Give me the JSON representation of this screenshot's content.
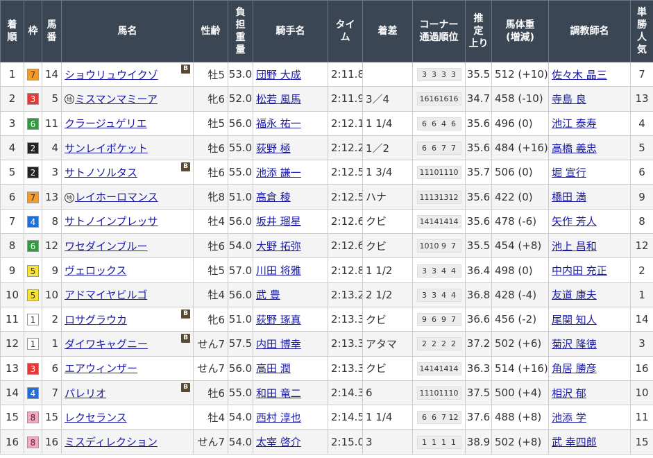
{
  "headers": [
    "着順",
    "枠",
    "馬番",
    "馬名",
    "性齢",
    "負担重量",
    "騎手名",
    "タイム",
    "着差",
    "コーナー通過順位",
    "推定上り",
    "馬体重(増減)",
    "調教師名",
    "単勝人気"
  ],
  "header_lines": {
    "rank": [
      "着",
      "順"
    ],
    "waku": [
      "枠"
    ],
    "umaban": [
      "馬",
      "番"
    ],
    "horse": [
      "馬名"
    ],
    "sexage": [
      "性齢"
    ],
    "weight": [
      "負",
      "担",
      "重",
      "量"
    ],
    "jockey": [
      "騎手名"
    ],
    "time": [
      "タイ",
      "ム"
    ],
    "margin": [
      "着差"
    ],
    "corner": [
      "コーナー",
      "通過順位"
    ],
    "agari": [
      "推",
      "定",
      "上り"
    ],
    "body": [
      "馬体重",
      "(増減)"
    ],
    "trainer": [
      "調教師名"
    ],
    "pop": [
      "単",
      "勝",
      "人",
      "気"
    ]
  },
  "icons": {
    "blinker_label": "B",
    "chihou_label": "地"
  },
  "waku_colors": {
    "1": {
      "bg": "#ffffff",
      "fg": "#333333"
    },
    "2": {
      "bg": "#222222",
      "fg": "#ffffff"
    },
    "3": {
      "bg": "#e53935",
      "fg": "#ffffff"
    },
    "4": {
      "bg": "#1e6fd9",
      "fg": "#ffffff"
    },
    "5": {
      "bg": "#f7e23a",
      "fg": "#333333"
    },
    "6": {
      "bg": "#2e9b3e",
      "fg": "#ffffff"
    },
    "7": {
      "bg": "#f39a2c",
      "fg": "#333333"
    },
    "8": {
      "bg": "#f5a9c0",
      "fg": "#333333"
    }
  },
  "rows": [
    {
      "rank": "1",
      "waku": "7",
      "umaban": "14",
      "horse": "ショウリュウイクゾ",
      "blinker": true,
      "chihou": false,
      "sexage": "牡5",
      "weight": "53.0",
      "jockey": "団野 大成",
      "time": "2:11.8",
      "margin": "",
      "corner": [
        "3",
        "3",
        "3",
        "3"
      ],
      "agari": "35.5",
      "body": "512 (+10)",
      "trainer": "佐々木 晶三",
      "pop": "7"
    },
    {
      "rank": "2",
      "waku": "3",
      "umaban": "5",
      "horse": "ミスマンマミーア",
      "blinker": false,
      "chihou": true,
      "sexage": "牝6",
      "weight": "52.0",
      "jockey": "松若 風馬",
      "time": "2:11.9",
      "margin": "3／4",
      "corner": [
        "16",
        "16",
        "16",
        "16"
      ],
      "agari": "34.7",
      "body": "458 (-10)",
      "trainer": "寺島 良",
      "pop": "13"
    },
    {
      "rank": "3",
      "waku": "6",
      "umaban": "11",
      "horse": "クラージュゲリエ",
      "blinker": false,
      "chihou": false,
      "sexage": "牡5",
      "weight": "56.0",
      "jockey": "福永 祐一",
      "time": "2:12.1",
      "margin": "1 1/4",
      "corner": [
        "6",
        "6",
        "4",
        "6"
      ],
      "agari": "35.6",
      "body": "496 (0)",
      "trainer": "池江 泰寿",
      "pop": "4"
    },
    {
      "rank": "4",
      "waku": "2",
      "umaban": "4",
      "horse": "サンレイポケット",
      "blinker": false,
      "chihou": false,
      "sexage": "牡6",
      "weight": "55.0",
      "jockey": "荻野 極",
      "time": "2:12.2",
      "margin": "1／2",
      "corner": [
        "6",
        "6",
        "7",
        "7"
      ],
      "agari": "35.6",
      "body": "484 (+16)",
      "trainer": "高橋 義忠",
      "pop": "5"
    },
    {
      "rank": "5",
      "waku": "2",
      "umaban": "3",
      "horse": "サトノソルタス",
      "blinker": true,
      "chihou": false,
      "sexage": "牡6",
      "weight": "55.0",
      "jockey": "池添 謙一",
      "time": "2:12.5",
      "margin": "1 3/4",
      "corner": [
        "11",
        "10",
        "11",
        "10"
      ],
      "agari": "35.7",
      "body": "506 (0)",
      "trainer": "堀 宣行",
      "pop": "6"
    },
    {
      "rank": "6",
      "waku": "7",
      "umaban": "13",
      "horse": "レイホーロマンス",
      "blinker": false,
      "chihou": true,
      "sexage": "牝8",
      "weight": "51.0",
      "jockey": "高倉 稜",
      "time": "2:12.5",
      "margin": "ハナ",
      "corner": [
        "11",
        "13",
        "13",
        "12"
      ],
      "agari": "35.6",
      "body": "422 (0)",
      "trainer": "橋田 満",
      "pop": "9"
    },
    {
      "rank": "7",
      "waku": "4",
      "umaban": "8",
      "horse": "サトノインプレッサ",
      "blinker": false,
      "chihou": false,
      "sexage": "牡4",
      "weight": "56.0",
      "jockey": "坂井 瑠星",
      "time": "2:12.6",
      "margin": "クビ",
      "corner": [
        "14",
        "14",
        "14",
        "14"
      ],
      "agari": "35.6",
      "body": "478 (-6)",
      "trainer": "矢作 芳人",
      "pop": "8"
    },
    {
      "rank": "8",
      "waku": "6",
      "umaban": "12",
      "horse": "ワセダインブルー",
      "blinker": false,
      "chihou": false,
      "sexage": "牡6",
      "weight": "54.0",
      "jockey": "大野 拓弥",
      "time": "2:12.6",
      "margin": "クビ",
      "corner": [
        "10",
        "10",
        "9",
        "7"
      ],
      "agari": "35.5",
      "body": "454 (+8)",
      "trainer": "池上 昌和",
      "pop": "12"
    },
    {
      "rank": "9",
      "waku": "5",
      "umaban": "9",
      "horse": "ヴェロックス",
      "blinker": false,
      "chihou": false,
      "sexage": "牡5",
      "weight": "57.0",
      "jockey": "川田 将雅",
      "time": "2:12.8",
      "margin": "1 1/2",
      "corner": [
        "3",
        "3",
        "4",
        "4"
      ],
      "agari": "36.4",
      "body": "498 (0)",
      "trainer": "中内田 充正",
      "pop": "2"
    },
    {
      "rank": "10",
      "waku": "5",
      "umaban": "10",
      "horse": "アドマイヤビルゴ",
      "blinker": false,
      "chihou": false,
      "sexage": "牡4",
      "weight": "56.0",
      "jockey": "武 豊",
      "time": "2:13.2",
      "margin": "2 1/2",
      "corner": [
        "3",
        "3",
        "4",
        "4"
      ],
      "agari": "36.8",
      "body": "428 (-4)",
      "trainer": "友道 康夫",
      "pop": "1"
    },
    {
      "rank": "11",
      "waku": "1",
      "umaban": "2",
      "horse": "ロサグラウカ",
      "blinker": true,
      "chihou": false,
      "sexage": "牝6",
      "weight": "51.0",
      "jockey": "荻野 琢真",
      "time": "2:13.3",
      "margin": "クビ",
      "corner": [
        "9",
        "6",
        "9",
        "7"
      ],
      "agari": "36.6",
      "body": "456 (-2)",
      "trainer": "尾関 知人",
      "pop": "14"
    },
    {
      "rank": "12",
      "waku": "1",
      "umaban": "1",
      "horse": "ダイワキャグニー",
      "blinker": true,
      "chihou": false,
      "sexage": "せん7",
      "weight": "57.5",
      "jockey": "内田 博幸",
      "time": "2:13.3",
      "margin": "アタマ",
      "corner": [
        "2",
        "2",
        "2",
        "2"
      ],
      "agari": "37.2",
      "body": "502 (+6)",
      "trainer": "菊沢 隆徳",
      "pop": "3"
    },
    {
      "rank": "13",
      "waku": "3",
      "umaban": "6",
      "horse": "エアウィンザー",
      "blinker": false,
      "chihou": false,
      "sexage": "せん7",
      "weight": "56.0",
      "jockey": "高田 潤",
      "time": "2:13.3",
      "margin": "クビ",
      "corner": [
        "14",
        "14",
        "14",
        "14"
      ],
      "agari": "36.3",
      "body": "514 (+16)",
      "trainer": "角居 勝彦",
      "pop": "16"
    },
    {
      "rank": "14",
      "waku": "4",
      "umaban": "7",
      "horse": "パレリオ",
      "blinker": true,
      "chihou": false,
      "sexage": "牡6",
      "weight": "55.0",
      "jockey": "和田 竜二",
      "time": "2:14.3",
      "margin": "6",
      "corner": [
        "11",
        "10",
        "11",
        "10"
      ],
      "agari": "37.5",
      "body": "500 (+4)",
      "trainer": "相沢 郁",
      "pop": "10"
    },
    {
      "rank": "15",
      "waku": "8",
      "umaban": "15",
      "horse": "レクセランス",
      "blinker": false,
      "chihou": false,
      "sexage": "牡4",
      "weight": "54.0",
      "jockey": "西村 淳也",
      "time": "2:14.5",
      "margin": "1 1/4",
      "corner": [
        "6",
        "6",
        "7",
        "12"
      ],
      "agari": "37.6",
      "body": "488 (+8)",
      "trainer": "池添 学",
      "pop": "11"
    },
    {
      "rank": "16",
      "waku": "8",
      "umaban": "16",
      "horse": "ミスディレクション",
      "blinker": false,
      "chihou": false,
      "sexage": "せん7",
      "weight": "54.0",
      "jockey": "太宰 啓介",
      "time": "2:15.0",
      "margin": "3",
      "corner": [
        "1",
        "1",
        "1",
        "1"
      ],
      "agari": "38.9",
      "body": "502 (+8)",
      "trainer": "武 幸四郎",
      "pop": "15"
    }
  ]
}
